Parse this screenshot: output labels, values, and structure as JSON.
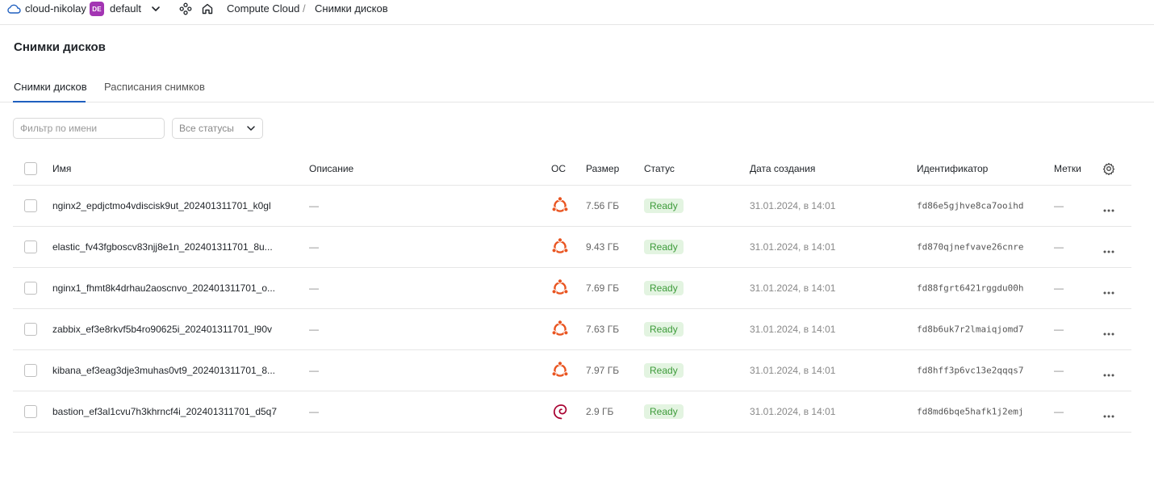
{
  "topbar": {
    "cloud_name": "cloud-nikolay",
    "folder_badge": "DE",
    "folder_name": "default",
    "breadcrumb": [
      "Compute Cloud",
      "Снимки дисков"
    ],
    "breadcrumb_sep": "/"
  },
  "page": {
    "title": "Снимки дисков"
  },
  "tabs": [
    {
      "label": "Снимки дисков",
      "active": true
    },
    {
      "label": "Расписания снимков",
      "active": false
    }
  ],
  "filters": {
    "name_placeholder": "Фильтр по имени",
    "status_value": "Все статусы"
  },
  "table": {
    "columns": [
      "Имя",
      "Описание",
      "ОС",
      "Размер",
      "Статус",
      "Дата создания",
      "Идентификатор",
      "Метки"
    ],
    "rows": [
      {
        "name": "nginx2_epdjctmo4vdiscisk9ut_202401311701_k0gl",
        "description": "—",
        "os": "ubuntu-icon",
        "size": "7.56 ГБ",
        "status": "Ready",
        "created": "31.01.2024, в 14:01",
        "id": "fd86e5gjhve8ca7ooihd",
        "labels": "—"
      },
      {
        "name": "elastic_fv43fgboscv83njj8e1n_202401311701_8u...",
        "description": "—",
        "os": "ubuntu-icon",
        "size": "9.43 ГБ",
        "status": "Ready",
        "created": "31.01.2024, в 14:01",
        "id": "fd870qjnefvave26cnre",
        "labels": "—"
      },
      {
        "name": "nginx1_fhmt8k4drhau2aoscnvo_202401311701_o...",
        "description": "—",
        "os": "ubuntu-icon",
        "size": "7.69 ГБ",
        "status": "Ready",
        "created": "31.01.2024, в 14:01",
        "id": "fd88fgrt6421rggdu00h",
        "labels": "—"
      },
      {
        "name": "zabbix_ef3e8rkvf5b4ro90625i_202401311701_l90v",
        "description": "—",
        "os": "ubuntu-icon",
        "size": "7.63 ГБ",
        "status": "Ready",
        "created": "31.01.2024, в 14:01",
        "id": "fd8b6uk7r2lmaiqjomd7",
        "labels": "—"
      },
      {
        "name": "kibana_ef3eag3dje3muhas0vt9_202401311701_8...",
        "description": "—",
        "os": "ubuntu-icon",
        "size": "7.97 ГБ",
        "status": "Ready",
        "created": "31.01.2024, в 14:01",
        "id": "fd8hff3p6vc13e2qqqs7",
        "labels": "—"
      },
      {
        "name": "bastion_ef3al1cvu7h3khrncf4i_202401311701_d5q7",
        "description": "—",
        "os": "debian-icon",
        "size": "2.9 ГБ",
        "status": "Ready",
        "created": "31.01.2024, в 14:01",
        "id": "fd8md6bqe5hafk1j2emj",
        "labels": "—"
      }
    ]
  },
  "colors": {
    "accent": "#1f5fbf",
    "folder_badge": "#a335b3",
    "ubuntu": "#e95420",
    "debian": "#a80030",
    "status_ready_bg": "#e3f4e1",
    "status_ready_text": "#3d9b3a"
  }
}
